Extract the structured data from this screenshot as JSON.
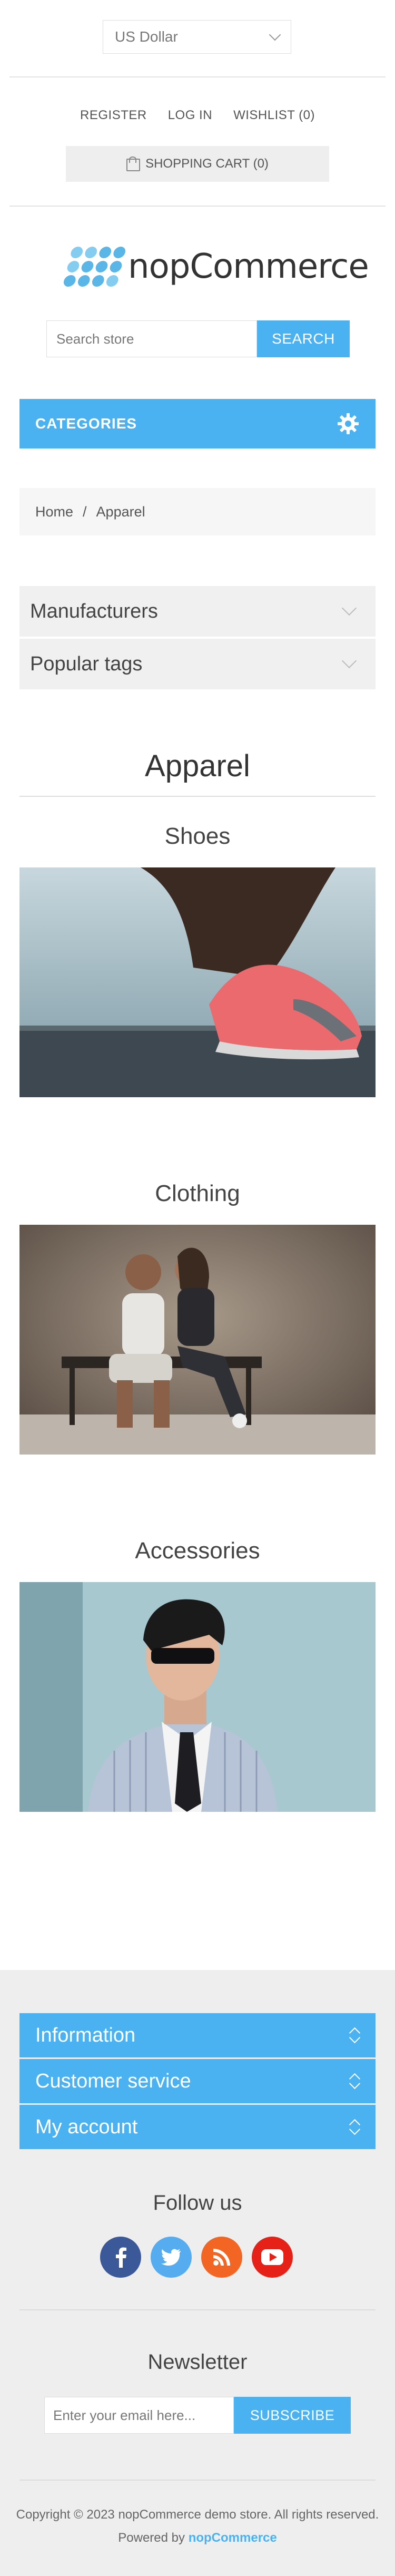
{
  "header": {
    "currency": "US Dollar",
    "links": [
      "REGISTER",
      "LOG IN",
      "WISHLIST (0)"
    ],
    "cart": "SHOPPING CART (0)"
  },
  "logo": {
    "text": "nopCommerce"
  },
  "search": {
    "placeholder": "Search store",
    "button": "SEARCH"
  },
  "categories": {
    "label": "CATEGORIES",
    "icon": "gear-icon"
  },
  "breadcrumb": {
    "home": "Home",
    "separator": "/",
    "current": "Apparel"
  },
  "side_blocks": [
    "Manufacturers",
    "Popular tags"
  ],
  "page": {
    "title": "Apparel",
    "subcategories": [
      "Shoes",
      "Clothing",
      "Accessories"
    ]
  },
  "footer": {
    "blocks": [
      "Information",
      "Customer service",
      "My account"
    ],
    "follow_title": "Follow us",
    "socials": [
      "facebook-icon",
      "twitter-icon",
      "rss-icon",
      "youtube-icon"
    ],
    "newsletter_title": "Newsletter",
    "newsletter_placeholder": "Enter your email here...",
    "subscribe_button": "SUBSCRIBE",
    "copyright": "Copyright © 2023 nopCommerce demo store. All rights reserved.",
    "powered_prefix": "Powered by",
    "powered_link": "nopCommerce"
  },
  "colors": {
    "accent": "#4ab2f1",
    "footer_bg": "#eeeeee"
  }
}
